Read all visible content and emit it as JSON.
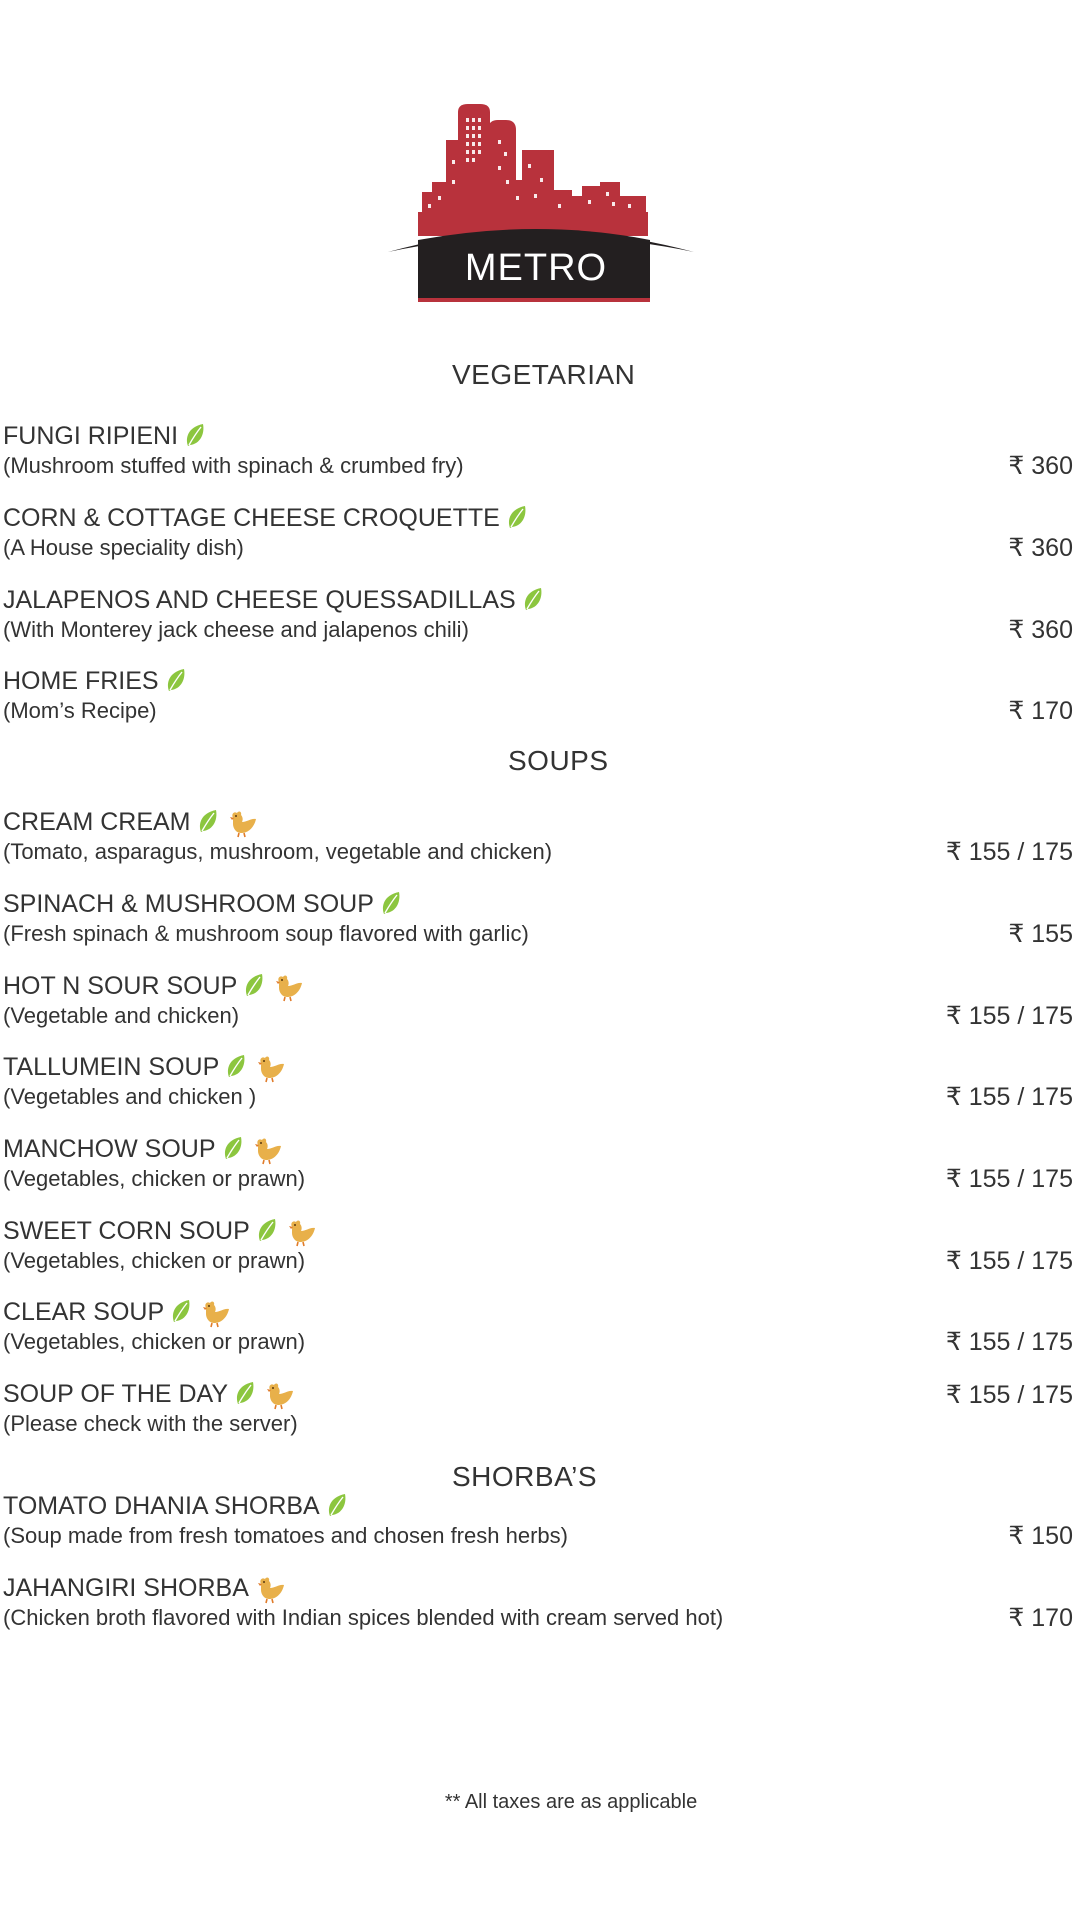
{
  "logo": {
    "text": "METRO",
    "icon": "city-skyline-logo"
  },
  "colors": {
    "logo_red": "#b8323c",
    "logo_dark": "#231f20",
    "leaf_green": "#8cc63f",
    "chicken_gold": "#e8b04a",
    "text": "#333333"
  },
  "sections": {
    "vegetarian": {
      "title": "VEGETARIAN"
    },
    "soups": {
      "title": "SOUPS"
    },
    "shorbas": {
      "title": "SHORBA’S"
    }
  },
  "items": [
    {
      "name": "FUNGI RIPIENI",
      "desc": "(Mushroom stuffed with spinach & crumbed fry)",
      "price": "₹ 360",
      "icons": [
        "leaf-icon"
      ]
    },
    {
      "name": "CORN & COTTAGE CHEESE CROQUETTE",
      "desc": "(A House speciality dish)",
      "price": "₹ 360",
      "icons": [
        "leaf-icon"
      ]
    },
    {
      "name": "JALAPENOS AND CHEESE QUESSADILLAS",
      "desc": "(With Monterey jack cheese and jalapenos chili)",
      "price": "₹ 360",
      "icons": [
        "leaf-icon"
      ]
    },
    {
      "name": "HOME FRIES",
      "desc": "(Mom’s Recipe)",
      "price": "₹ 170",
      "icons": [
        "leaf-icon"
      ]
    },
    {
      "name": "CREAM CREAM",
      "desc": "(Tomato, asparagus, mushroom, vegetable and chicken)",
      "price": "₹ 155 / 175",
      "icons": [
        "leaf-icon",
        "chicken-icon"
      ]
    },
    {
      "name": "SPINACH & MUSHROOM SOUP",
      "desc": "(Fresh spinach & mushroom soup flavored with garlic)",
      "price": "₹ 155",
      "icons": [
        "leaf-icon"
      ]
    },
    {
      "name": "HOT N SOUR SOUP",
      "desc": "(Vegetable and chicken)",
      "price": "₹ 155 / 175",
      "icons": [
        "leaf-icon",
        "chicken-icon"
      ]
    },
    {
      "name": "TALLUMEIN SOUP",
      "desc": "(Vegetables and chicken )",
      "price": "₹ 155 / 175",
      "icons": [
        "leaf-icon",
        "chicken-icon"
      ]
    },
    {
      "name": "MANCHOW SOUP",
      "desc": "(Vegetables, chicken or prawn)",
      "price": "₹ 155 / 175",
      "icons": [
        "leaf-icon",
        "chicken-icon"
      ]
    },
    {
      "name": "SWEET CORN SOUP",
      "desc": "(Vegetables, chicken or prawn)",
      "price": "₹ 155 / 175",
      "icons": [
        "leaf-icon",
        "chicken-icon"
      ]
    },
    {
      "name": "CLEAR SOUP",
      "desc": "(Vegetables, chicken or prawn)",
      "price": "₹ 155 / 175",
      "icons": [
        "leaf-icon",
        "chicken-icon"
      ]
    },
    {
      "name": "SOUP OF THE DAY",
      "desc": "(Please check with the server)",
      "price": "₹ 155 / 175",
      "icons": [
        "leaf-icon",
        "chicken-icon"
      ]
    },
    {
      "name": "TOMATO DHANIA SHORBA",
      "desc": "(Soup made from fresh tomatoes and chosen fresh herbs)",
      "price": "₹ 150",
      "icons": [
        "leaf-icon"
      ]
    },
    {
      "name": "JAHANGIRI SHORBA",
      "desc": "(Chicken broth flavored with Indian spices blended with cream served hot)",
      "price": "₹ 170",
      "icons": [
        "chicken-icon"
      ]
    }
  ],
  "footer": {
    "note": "** All taxes are as applicable"
  }
}
